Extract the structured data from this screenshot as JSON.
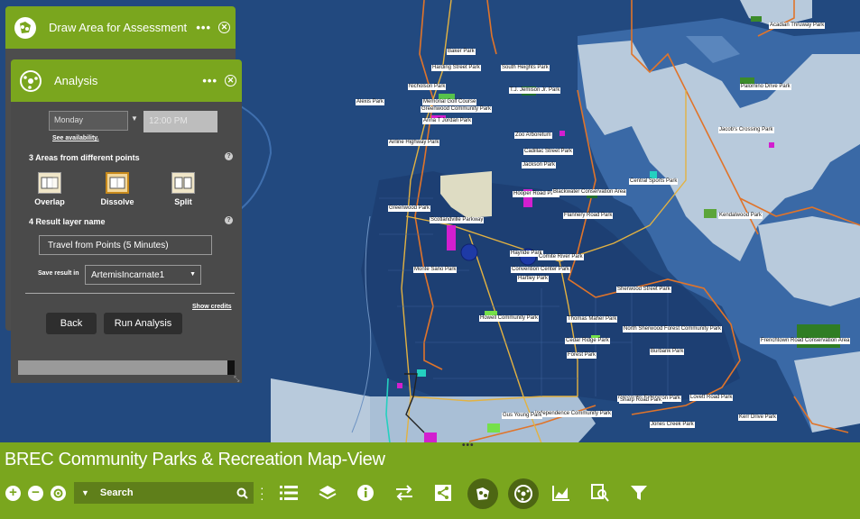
{
  "panels": {
    "draw_area": {
      "title": "Draw Area for Assessment",
      "dots": "•••",
      "close": "✕"
    },
    "analysis": {
      "title": "Analysis",
      "dots": "•••",
      "close": "✕",
      "day_value": "Monday",
      "time_placeholder": "12:00 PM",
      "see_availability": "See availability.",
      "step3_label": "3 Areas from different points",
      "options": [
        {
          "label": "Overlap"
        },
        {
          "label": "Dissolve"
        },
        {
          "label": "Split"
        }
      ],
      "step4_label": "4 Result layer name",
      "result_name": "Travel from Points (5 Minutes)",
      "save_label": "Save result in",
      "save_value": "ArtemisIncarnate1",
      "show_credits": "Show credits",
      "back_label": "Back",
      "run_label": "Run Analysis",
      "help": "?"
    }
  },
  "bottom_bar": {
    "title": "BREC Community Parks & Recreation Map-View",
    "search_placeholder": "Search",
    "dots": "•••"
  },
  "map": {
    "park_labels": [
      "Baker Park",
      "Harding Street Park",
      "South Heights Park",
      "Nicholson Park",
      "Palomino Drive Park",
      "Acadian Thruway Park",
      "Memorial Golf Course",
      "Greenwood Community Park",
      "Anna T Jordan Park",
      "T.J. Jemison Jr. Park",
      "Alexis Park",
      "Scotlandville Parkway",
      "Hooper Road Park",
      "Zoo Arboretum",
      "Cadillac Street Park",
      "Jackson Park",
      "Jacob's Crossing Park",
      "Airline Highway Park",
      "Blackwater Conservation Area",
      "Central Sports Park",
      "Kendalwood Park",
      "Greenwood Park",
      "Flannery Road Park",
      "Sherwood Street Park",
      "Thomas Maher Park",
      "Howell Community Park",
      "Cedar Ridge Park",
      "Forest Park",
      "Burbank Park",
      "Greenville Extension Park",
      "Independence Community Park",
      "Hayride Park",
      "Lovett Road Park",
      "Frenchtown Road Conservation Area",
      "Sharp Road Park",
      "Jones Creek Park",
      "Monte Sano Park",
      "Kerr Drive Park",
      "North Sherwood Forest Community Park",
      "Gus Young Park",
      "Convention Center Park",
      "Comite River Park",
      "Hartley Park"
    ]
  }
}
